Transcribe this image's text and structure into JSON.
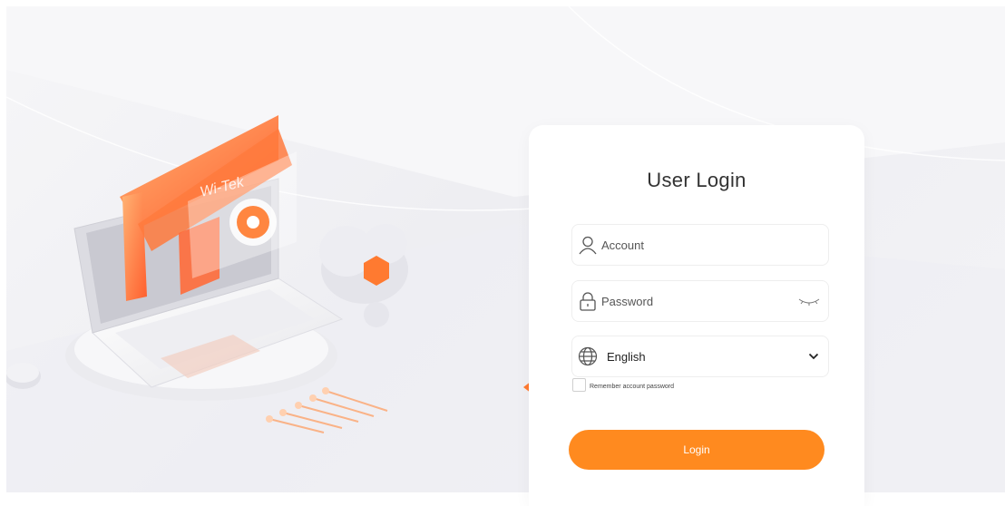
{
  "brand": {
    "logo_text": "Wi-Tek"
  },
  "login": {
    "title": "User Login",
    "account_placeholder": "Account",
    "password_placeholder": "Password",
    "language_selected": "English",
    "remember_label": "Remember account password",
    "login_button": "Login"
  },
  "icons": {
    "account": "user-icon",
    "password": "lock-icon",
    "toggle": "eye-closed-icon",
    "language": "globe-icon",
    "dropdown": "chevron-down-icon"
  },
  "colors": {
    "accent": "#ff8a1f",
    "background": "#f3f3f6",
    "card": "#ffffff"
  }
}
